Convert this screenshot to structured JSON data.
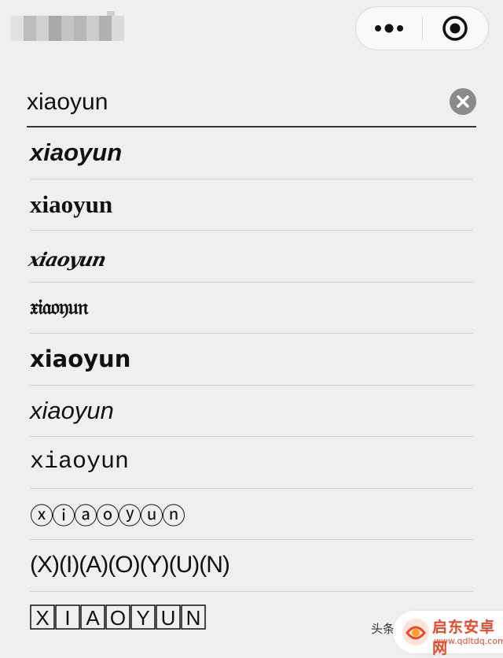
{
  "search": {
    "value": "xiaoyun"
  },
  "results": [
    "𝙭𝙞𝙖𝙤𝙮𝙪𝙣",
    "xiaoyun",
    "xiaoyun",
    "𝔵𝔦𝔞𝔬𝔶𝔲𝔫",
    "xiaoyun",
    "xiaoyun",
    "𝚡𝚒𝚊𝚘𝚢𝚞𝚗",
    "ⓧⓘⓐⓞⓨⓤⓝ",
    "⒳⒤⒜⒪⒴⒰⒩",
    "🅇🄸🄰🄾🅈🅄🄽"
  ],
  "results_display": [
    "xiaoyun",
    "xiaoyun",
    "xiaoyun",
    "𝔵𝔦𝔞𝔬𝔶𝔲𝔫",
    "xiaoyun",
    "xiaoyun",
    "xiaoyun",
    "ⓧⓘⓐⓞⓨⓤⓝ",
    "(X)(I)(A)(O)(Y)(U)(N)",
    "XIAOYUN"
  ],
  "watermark": {
    "prefix": "头条",
    "name": "启东安卓网",
    "url": "www.qdltdq.com"
  },
  "colors": {
    "background": "#efefef",
    "underline": "#333333",
    "clear_icon": "#8a8a8a",
    "watermark_red": "#e8482c"
  }
}
